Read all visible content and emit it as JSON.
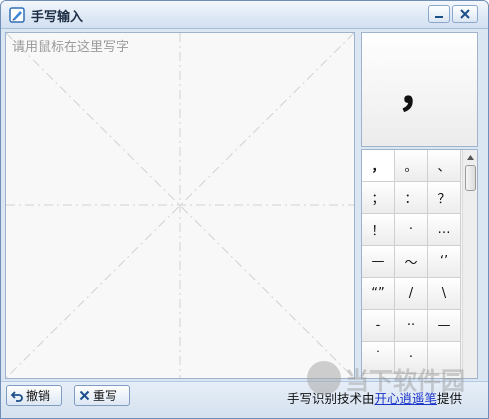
{
  "window": {
    "title": "手写输入",
    "minimize_label": "—",
    "close_label": "✕"
  },
  "pad": {
    "hint": "请用鼠标在这里写字"
  },
  "preview": {
    "char": "，"
  },
  "candidates": [
    "，",
    "。",
    "、",
    "；",
    "：",
    "？",
    "！",
    "·",
    "…",
    "—",
    "～",
    "‘’",
    "“”",
    "/",
    "\\",
    "-",
    "··",
    "—",
    "˙",
    "·",
    ""
  ],
  "toolbar": {
    "undo_label": "撤销",
    "rewrite_label": "重写"
  },
  "credit": {
    "prefix": "手写识别技术由",
    "link": "开心逍遥笔",
    "suffix": "提供"
  },
  "watermark": {
    "text": "当下软件园"
  },
  "colors": {
    "accent": "#6f8fb6",
    "link": "#1a33c8"
  }
}
